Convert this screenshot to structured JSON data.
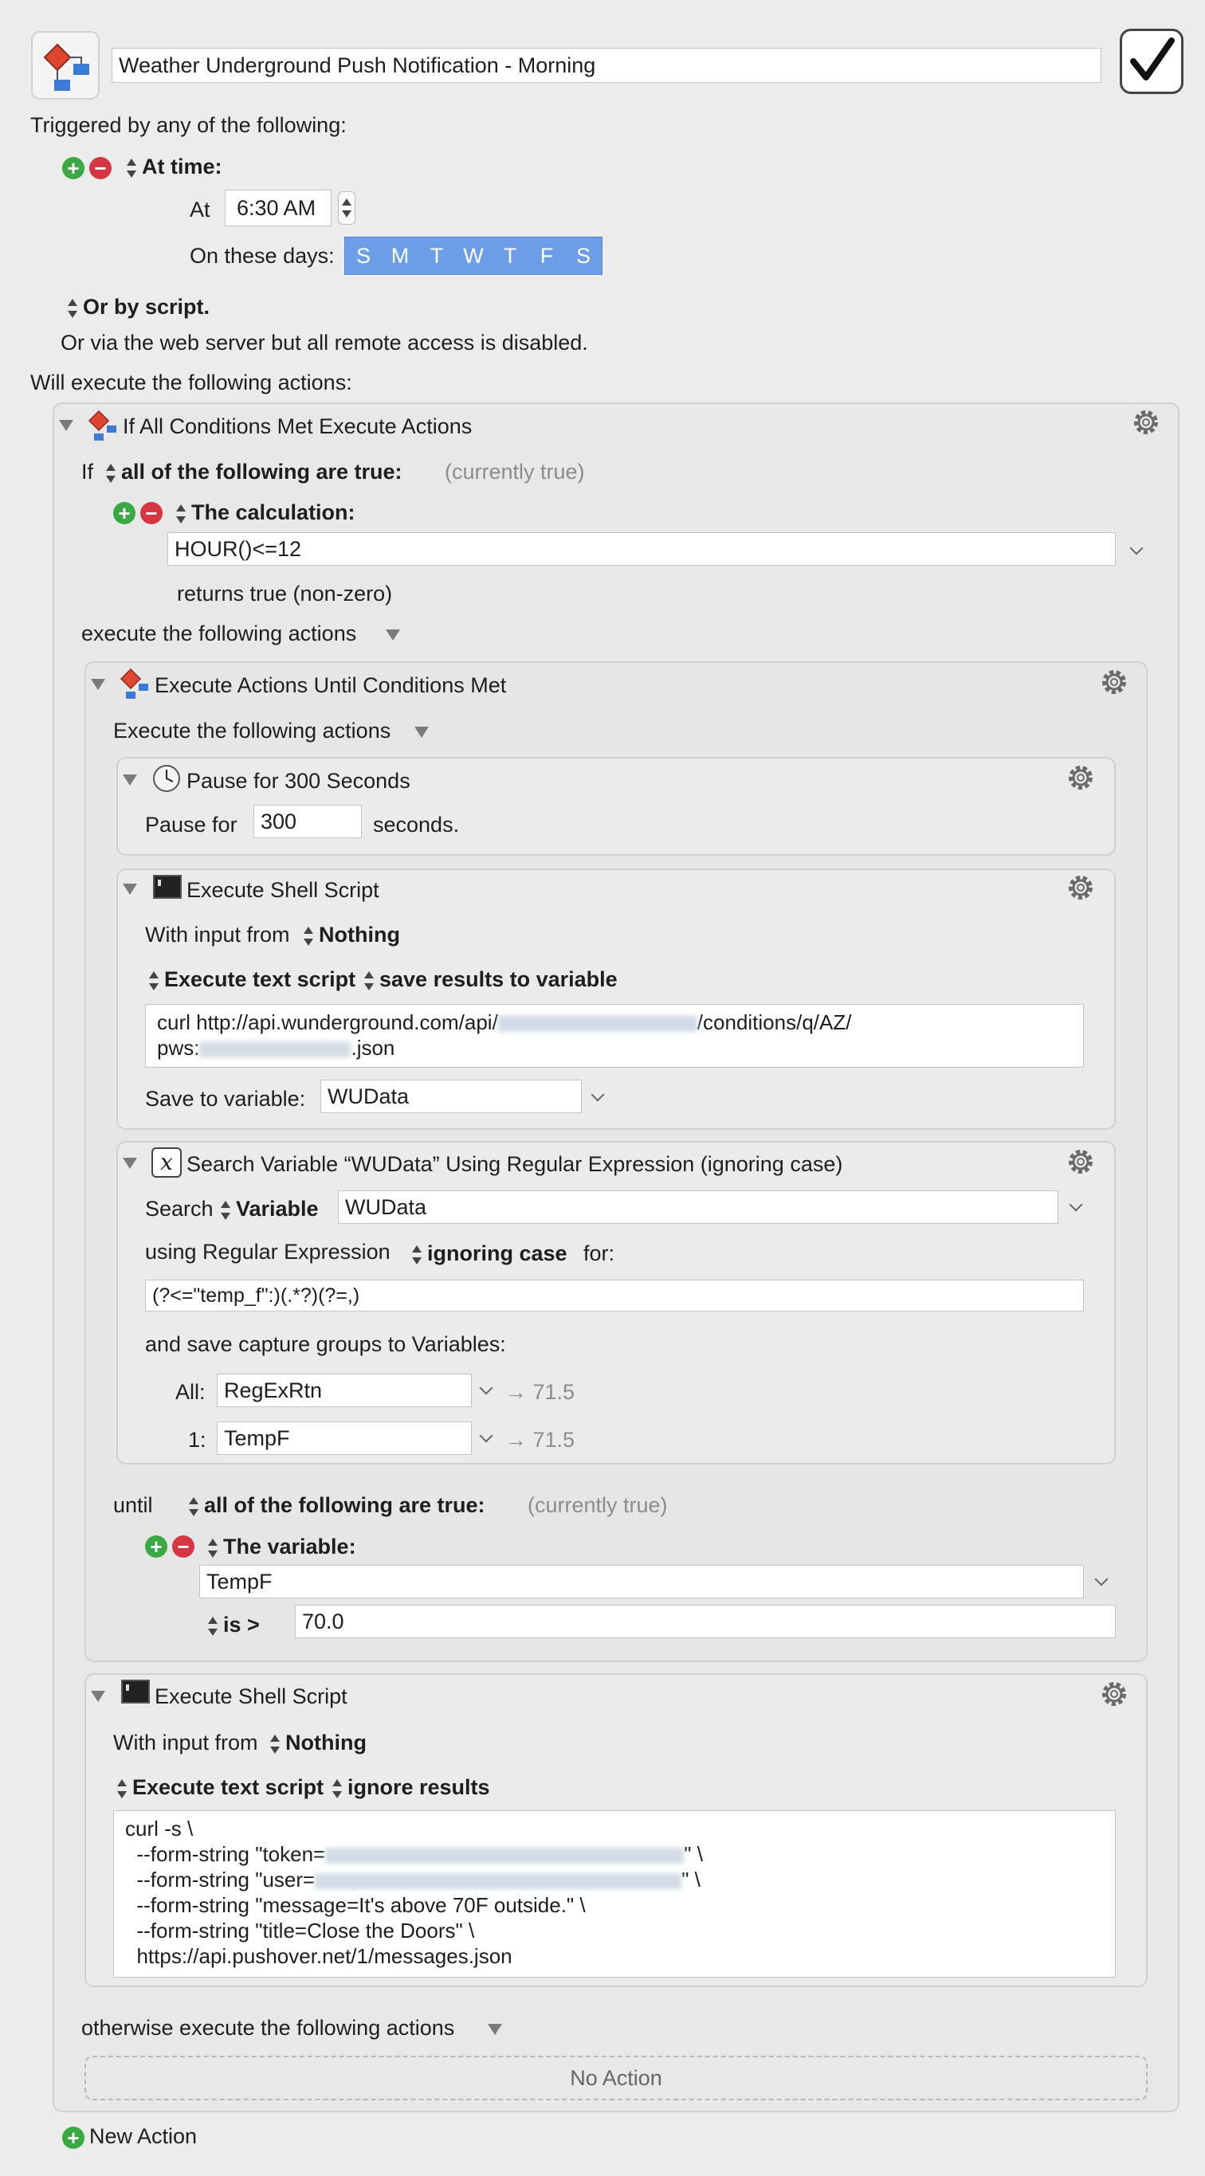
{
  "macro": {
    "name": "Weather Underground Push Notification - Morning",
    "enabled": true
  },
  "trigger": {
    "heading": "Triggered by any of the following:",
    "at_time_label": "At time:",
    "at_label": "At",
    "time_value": "6:30 AM",
    "days_label": "On these days:",
    "days": [
      "S",
      "M",
      "T",
      "W",
      "T",
      "F",
      "S"
    ],
    "script_label": "Or by script.",
    "web_server_note": "Or via the web server but all remote access is disabled."
  },
  "actions_heading": "Will execute the following actions:",
  "if_block": {
    "title": "If All Conditions Met Execute Actions",
    "if_label": "If",
    "condition_mode": "all of the following are true:",
    "status": "(currently true)",
    "calc_label": "The calculation:",
    "calc_value": "HOUR()<=12",
    "returns_note": "returns true (non-zero)",
    "then_label": "execute the following actions",
    "otherwise_label": "otherwise execute the following actions",
    "no_action": "No Action"
  },
  "until_block": {
    "title": "Execute Actions Until Conditions Met",
    "sub_label": "Execute the following actions",
    "until_label": "until",
    "condition_mode": "all of the following are true:",
    "status": "(currently true)",
    "var_label": "The variable:",
    "var_value": "TempF",
    "op_label": "is >",
    "op_value": "70.0"
  },
  "pause_action": {
    "title": "Pause for 300 Seconds",
    "label": "Pause for",
    "value": "300",
    "unit": "seconds."
  },
  "shell1": {
    "title": "Execute Shell Script",
    "input_label": "With input from",
    "input_value": "Nothing",
    "mode": "Execute text script",
    "result_mode": "save results to variable",
    "script_line1a": "curl http://api.wunderground.com/api/",
    "script_line1b": "/conditions/q/AZ/",
    "script_line2a": "pws:",
    "script_line2b": ".json",
    "save_label": "Save to variable:",
    "save_value": "WUData"
  },
  "regex_action": {
    "title": "Search Variable “WUData” Using Regular Expression (ignoring case)",
    "search_label": "Search",
    "search_type": "Variable",
    "search_value": "WUData",
    "using_label": "using Regular Expression",
    "case_mode": "ignoring case",
    "for_label": "for:",
    "pattern": "(?<=\"temp_f\":)(.*?)(?=,)",
    "save_label": "and save capture groups to Variables:",
    "all_label": "All:",
    "all_value": "RegExRtn",
    "all_result": "→ 71.5",
    "one_label": "1:",
    "one_value": "TempF",
    "one_result": "→ 71.5"
  },
  "shell2": {
    "title": "Execute Shell Script",
    "input_label": "With input from",
    "input_value": "Nothing",
    "mode": "Execute text script",
    "result_mode": "ignore results",
    "line1": "curl -s \\",
    "line2a": "  --form-string \"token=",
    "line2b": "\" \\",
    "line3a": "  --form-string \"user=",
    "line3b": "\" \\",
    "line4": "  --form-string \"message=It's above 70F outside.\" \\",
    "line5": "  --form-string \"title=Close the Doors\" \\",
    "line6": "  https://api.pushover.net/1/messages.json"
  },
  "new_action": "New Action",
  "colors": {
    "day_selected": "#6c9ee8",
    "plus": "#3aa843",
    "minus": "#d63642"
  }
}
